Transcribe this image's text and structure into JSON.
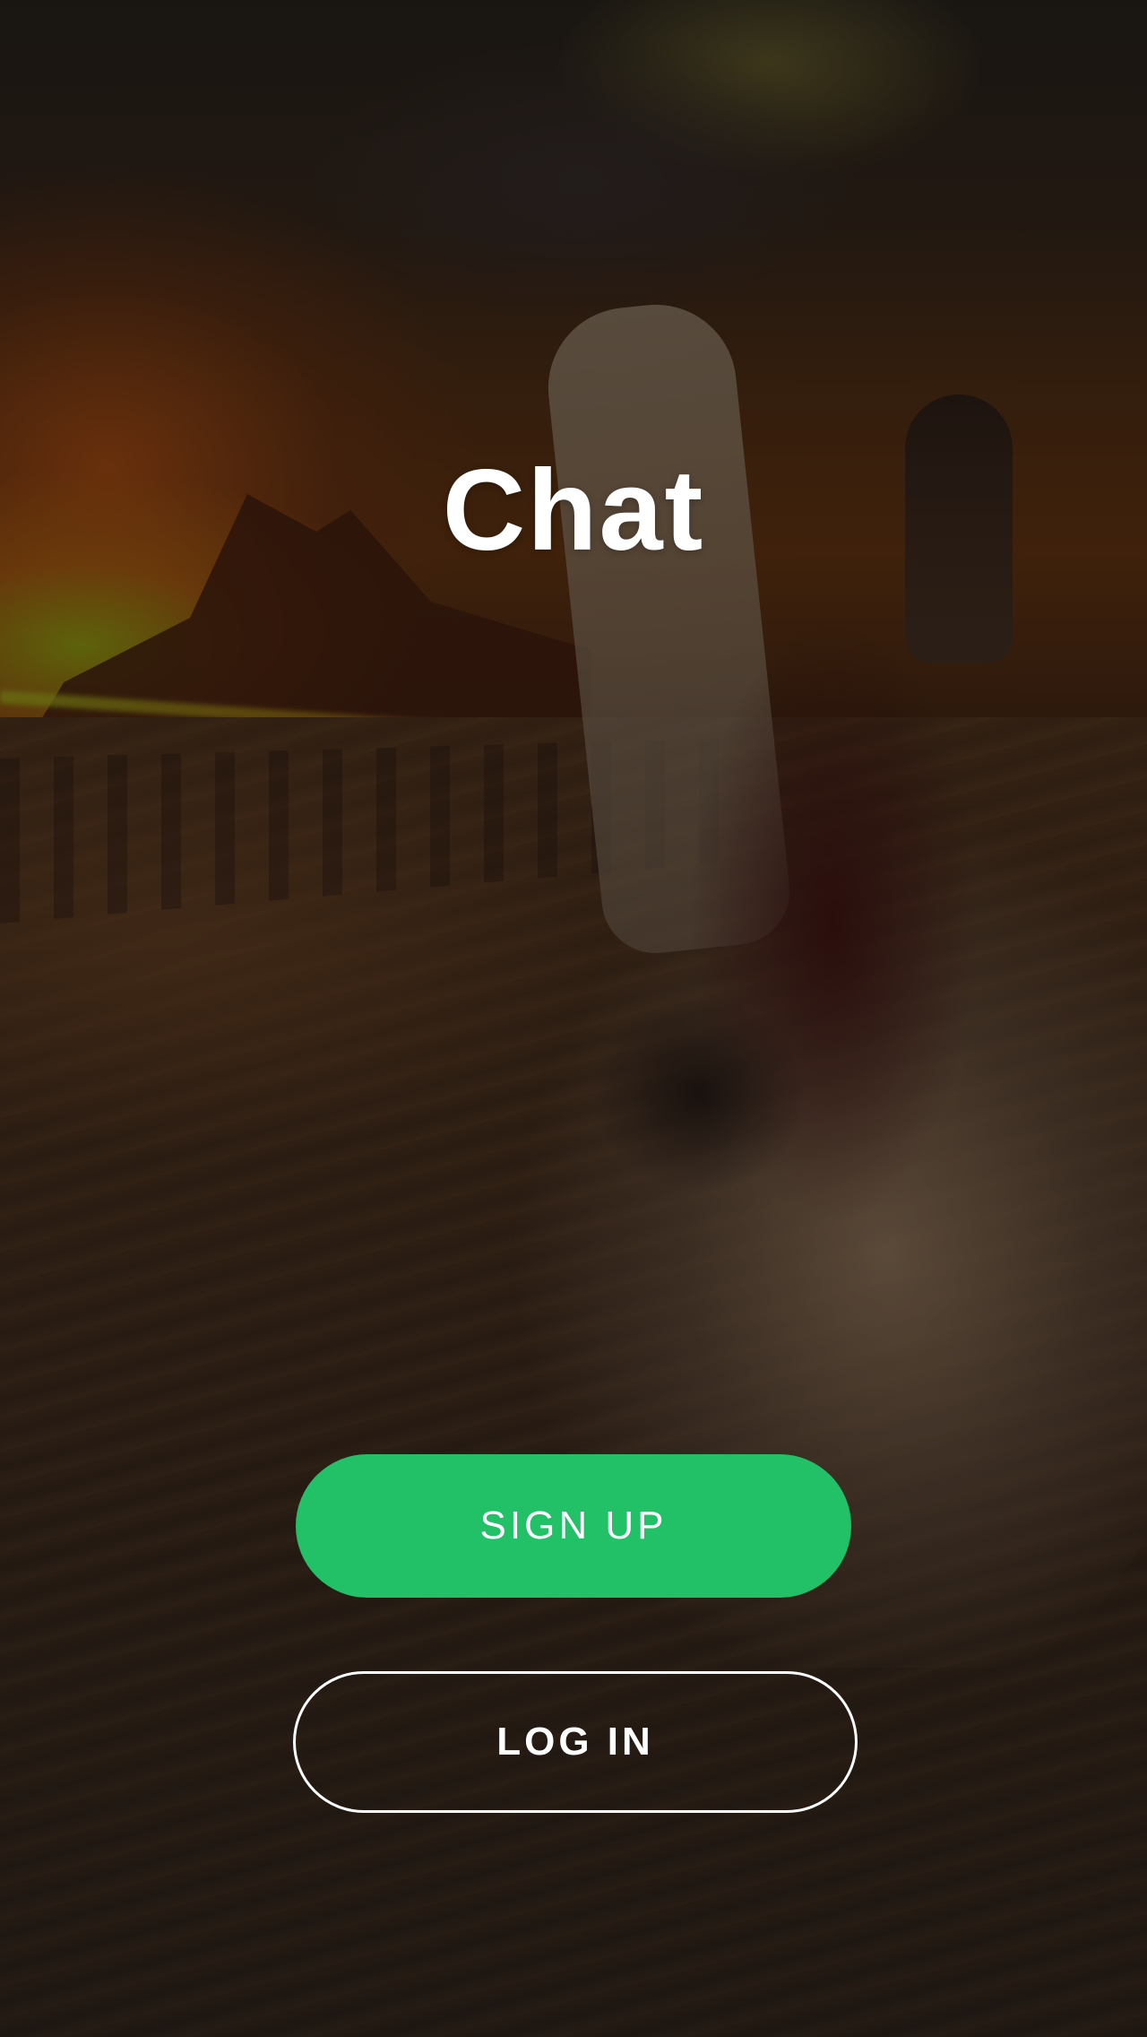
{
  "app": {
    "title": "Chat"
  },
  "background": {
    "icon": "sunset-beach-dog-photo"
  },
  "actions": {
    "signup_label": "SIGN UP",
    "login_label": "LOG IN"
  },
  "colors": {
    "accent": "#22c067",
    "text": "#ffffff",
    "overlay": "rgba(0,0,0,0.42)"
  }
}
